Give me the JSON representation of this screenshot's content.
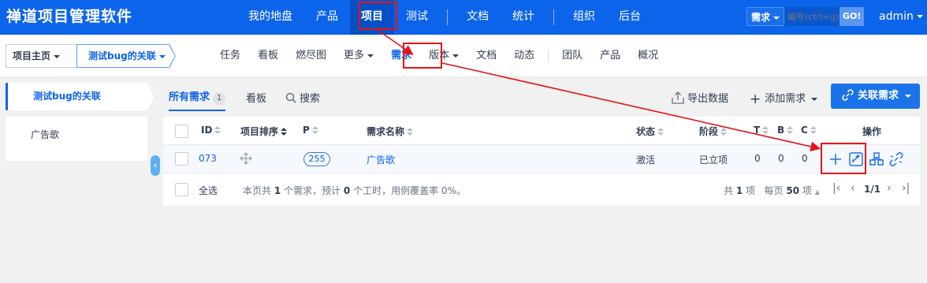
{
  "app": {
    "brand": "禅道项目管理软件",
    "nav": [
      "我的地盘",
      "产品",
      "项目",
      "测试",
      "文档",
      "统计",
      "组织",
      "后台"
    ],
    "search": {
      "type": "需求",
      "placeholder": "编号(ctrl+g)",
      "go": "GO!"
    },
    "user": "admin"
  },
  "subnav": {
    "crumbs": [
      "项目主页",
      "测试bug的关联"
    ],
    "items": [
      "任务",
      "看板",
      "燃尽图",
      "更多",
      "需求",
      "版本",
      "文档",
      "动态",
      "团队",
      "产品",
      "概况"
    ]
  },
  "sidebar": {
    "active": "测试bug的关联",
    "items": [
      "广告歌"
    ]
  },
  "toolbar": {
    "tab_all": "所有需求",
    "tab_all_count": "1",
    "tab_kanban": "看板",
    "tab_search": "搜索",
    "export": "导出数据",
    "add": "添加需求",
    "link": "关联需求"
  },
  "table": {
    "headers": {
      "id": "ID",
      "order": "项目排序",
      "pri": "P",
      "name": "需求名称",
      "status": "状态",
      "stage": "阶段",
      "t": "T",
      "b": "B",
      "c": "C",
      "actions": "操作"
    },
    "rows": [
      {
        "id": "073",
        "pri": "255",
        "name": "广告歌",
        "status": "激活",
        "stage": "已立项",
        "t": "0",
        "b": "0",
        "c": "0"
      }
    ],
    "footer": {
      "select_all": "全选",
      "summary_pre": "本页共",
      "count": "1",
      "summary_mid1": "个需求，预计",
      "hours": "0",
      "summary_mid2": "个工时，用例覆盖率",
      "coverage": "0%。",
      "total_pre": "共",
      "total": "1",
      "total_unit": "项",
      "per_page_pre": "每页",
      "per_page": "50",
      "per_page_unit": "项",
      "page": "1/1"
    }
  },
  "colors": {
    "primary": "#0c64eb",
    "annotation": "#e4131a"
  }
}
